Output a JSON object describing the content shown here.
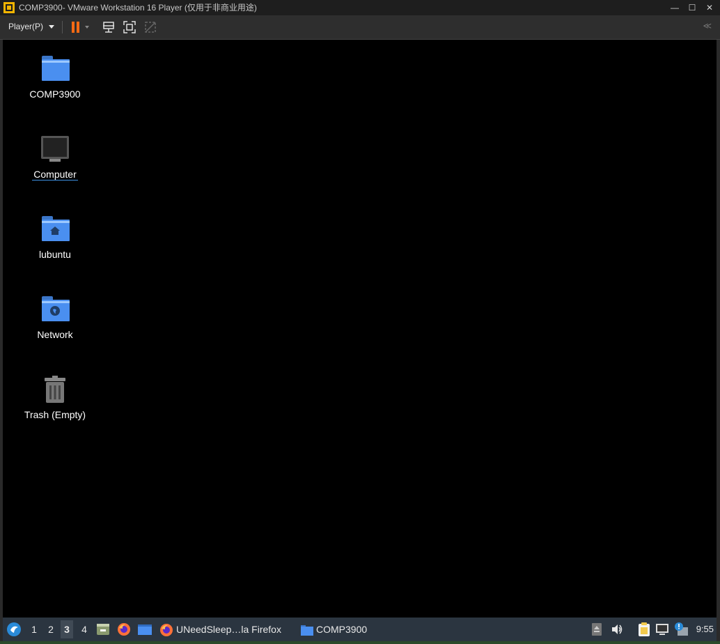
{
  "window": {
    "title": "COMP3900- VMware Workstation 16 Player (仅用于非商业用途)",
    "minimize": "—",
    "maximize": "☐",
    "close": "✕"
  },
  "toolbar": {
    "player_menu": "Player(P)",
    "collapse": "≪"
  },
  "desktop": {
    "icons": [
      {
        "label": "COMP3900",
        "icon": "folder-icon"
      },
      {
        "label": "Computer",
        "icon": "monitor-icon",
        "selected": true
      },
      {
        "label": "lubuntu",
        "icon": "home-folder-icon"
      },
      {
        "label": "Network",
        "icon": "network-folder-icon"
      },
      {
        "label": "Trash (Empty)",
        "icon": "trash-icon"
      }
    ]
  },
  "taskbar": {
    "workspaces": [
      "1",
      "2",
      "3",
      "4"
    ],
    "active_workspace": "3",
    "tasks": [
      {
        "label": "UNeedSleep…la Firefox",
        "icon": "firefox-icon"
      },
      {
        "label": "COMP3900",
        "icon": "folder-icon"
      }
    ],
    "clock": "9:55"
  },
  "colors": {
    "accent_pause": "#ff6a13",
    "folder_blue": "#4a8ff0",
    "taskbar_bg": "#2b3540"
  }
}
